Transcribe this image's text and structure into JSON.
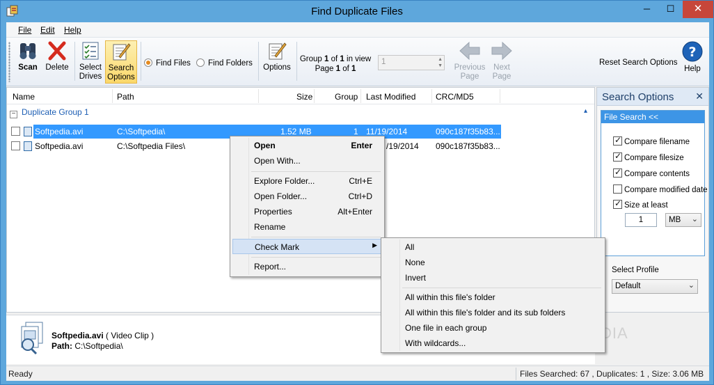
{
  "window": {
    "title": "Find Duplicate Files",
    "min": "─",
    "max": "☐",
    "close": "✕"
  },
  "menu": {
    "file": "File",
    "edit": "Edit",
    "help": "Help"
  },
  "toolbar": {
    "scan": "Scan",
    "delete": "Delete",
    "select": "Select",
    "drives": "Drives",
    "search": "Search",
    "options_word": "Options",
    "find_files": "Find Files",
    "find_folders": "Find Folders",
    "options": "Options",
    "group_label": "Group",
    "group_num": "1",
    "of": "of",
    "group_total": "1",
    "in_view": "in view",
    "page_label": "Page",
    "page_num": "1",
    "page_total": "1",
    "page_field": "1",
    "previous": "Previous",
    "next": "Next",
    "page_word": "Page",
    "reset": "Reset Search Options",
    "help": "Help"
  },
  "columns": {
    "name": "Name",
    "path": "Path",
    "size": "Size",
    "group": "Group",
    "modified": "Last Modified",
    "crc": "CRC/MD5"
  },
  "group": {
    "title": "Duplicate Group 1",
    "chevron": "▴"
  },
  "rows": [
    {
      "name": "Softpedia.avi",
      "path": "C:\\Softpedia\\",
      "size": "1.52 MB",
      "group": "1",
      "modified": "11/19/2014",
      "crc": "090c187f35b83..."
    },
    {
      "name": "Softpedia.avi",
      "path": "C:\\Softpedia Files\\",
      "size": "",
      "group": "",
      "modified": "/19/2014",
      "crc": "090c187f35b83..."
    }
  ],
  "detail": {
    "name": "Softpedia.avi",
    "type": "( Video Clip )",
    "path_label": "Path:",
    "path": "C:\\Softpedia\\"
  },
  "status": {
    "left": "Ready",
    "right": "Files Searched: 67 ,  Duplicates: 1 , Size: 3.06 MB"
  },
  "side": {
    "title": "Search Options",
    "close": "✕",
    "section": "File Search <<",
    "compare_filename": "Compare filename",
    "compare_filesize": "Compare filesize",
    "compare_contents": "Compare contents",
    "compare_modified": "Compare modified date",
    "size_at_least": "Size at least",
    "size_value": "1",
    "size_unit": "MB",
    "profile_label": "Select Profile",
    "profile": "Default"
  },
  "context_menu": {
    "open": "Open",
    "open_key": "Enter",
    "open_with": "Open With...",
    "explore": "Explore Folder...",
    "explore_key": "Ctrl+E",
    "open_folder": "Open Folder...",
    "open_folder_key": "Ctrl+D",
    "properties": "Properties",
    "properties_key": "Alt+Enter",
    "rename": "Rename",
    "check_mark": "Check Mark",
    "report": "Report..."
  },
  "submenu": {
    "all": "All",
    "none": "None",
    "invert": "Invert",
    "within_folder": "All within this file's folder",
    "within_sub": "All within this file's folder and its sub folders",
    "one_each": "One file in each group",
    "wildcards": "With wildcards..."
  },
  "watermark": "SOFTPEDIA"
}
